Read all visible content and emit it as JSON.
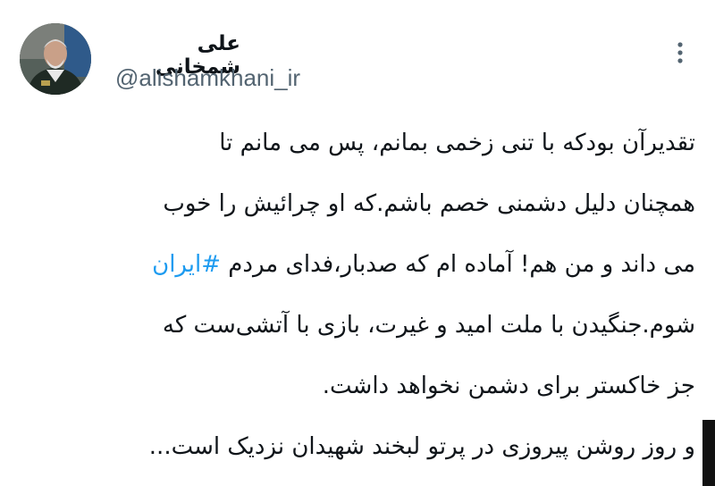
{
  "author": {
    "display_name": "علی شمخانی",
    "handle": "@alishamkhani_ir",
    "avatar_icon": "profile-photo"
  },
  "menu": {
    "icon": "more-vertical-icon"
  },
  "tweet": {
    "line1": "تقدیرآن بودکه با تنی زخمی بمانم، پس می مانم تا",
    "line2": "همچنان دلیل دشمنی خصم باشم.که او چرائیش را خوب",
    "line3_before": "می داند و من هم! آماده ام که صدبار،فدای مردم ",
    "hashtag": "#ایران",
    "line4": "شوم.جنگیدن با ملت امید و غیرت، بازی با آتشی‌ست که",
    "line5": "جز خاکستر برای دشمن نخواهد داشت.",
    "line6": "و روز روشن پیروزی در پرتو لبخند شهیدان نزدیک است..."
  },
  "colors": {
    "link": "#1d9bf0",
    "secondary": "#536471",
    "text": "#0f1419"
  }
}
